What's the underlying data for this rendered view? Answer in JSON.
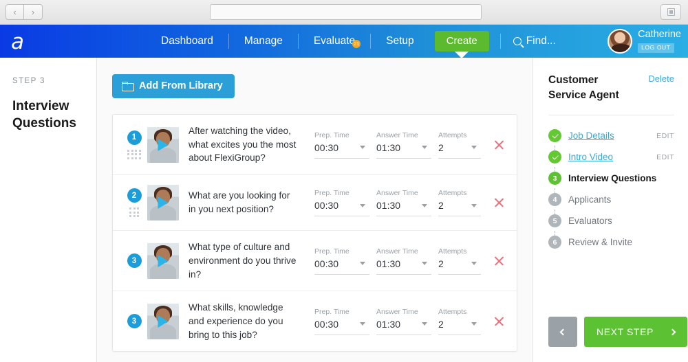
{
  "browser": {
    "back_label": "‹",
    "forward_label": "›",
    "url_value": "",
    "url_placeholder": ""
  },
  "topnav": {
    "brand": "a",
    "items": [
      {
        "label": "Dashboard",
        "badge": ""
      },
      {
        "label": "Manage",
        "badge": ""
      },
      {
        "label": "Evaluate",
        "badge": "21"
      },
      {
        "label": "Setup",
        "badge": ""
      }
    ],
    "cta_label": "Create",
    "find_label": "Find...",
    "user_name": "Catherine",
    "logout_label": "LOG OUT",
    "colors": {
      "gradient_start": "#0a3ae4",
      "gradient_end": "#2aaee4",
      "cta_green": "#5cba2e",
      "badge_orange": "#f5a623"
    }
  },
  "left_rail": {
    "eyebrow": "STEP 3",
    "title": "Interview Questions"
  },
  "main": {
    "add_library_label": "Add From Library",
    "field_labels": {
      "prep": "Prep. Time",
      "answer": "Answer Time",
      "attempts": "Attempts"
    },
    "questions": [
      {
        "number": "1",
        "text": "After watching the video, what excites you the most about FlexiGroup?",
        "prep_time": "00:30",
        "answer_time": "01:30",
        "attempts": "2"
      },
      {
        "number": "2",
        "text": "What are you looking for in you next position?",
        "prep_time": "00:30",
        "answer_time": "01:30",
        "attempts": "2"
      },
      {
        "number": "3",
        "text": "What type of culture and environment do you thrive in?",
        "prep_time": "00:30",
        "answer_time": "01:30",
        "attempts": "2"
      },
      {
        "number": "3",
        "text": "What skills, knowledge and experience do you bring to this job?",
        "prep_time": "00:30",
        "answer_time": "01:30",
        "attempts": "2"
      }
    ]
  },
  "right_panel": {
    "title": "Customer Service Agent",
    "delete_label": "Delete",
    "steps": [
      {
        "bullet": "✓",
        "state": "done",
        "label": "Job Details",
        "edit": "EDIT"
      },
      {
        "bullet": "✓",
        "state": "done",
        "label": "Intro Video",
        "edit": "EDIT"
      },
      {
        "bullet": "3",
        "state": "active",
        "label": "Interview Questions",
        "edit": ""
      },
      {
        "bullet": "4",
        "state": "pending",
        "label": "Applicants",
        "edit": ""
      },
      {
        "bullet": "5",
        "state": "pending",
        "label": "Evaluators",
        "edit": ""
      },
      {
        "bullet": "6",
        "state": "pending",
        "label": "Review & Invite",
        "edit": ""
      }
    ],
    "back_label": "‹",
    "next_label": "NEXT STEP",
    "colors": {
      "link_blue": "#3aa9d6",
      "done_green": "#64c832",
      "pending_gray": "#aeb5bb",
      "next_green": "#5cc133"
    }
  }
}
